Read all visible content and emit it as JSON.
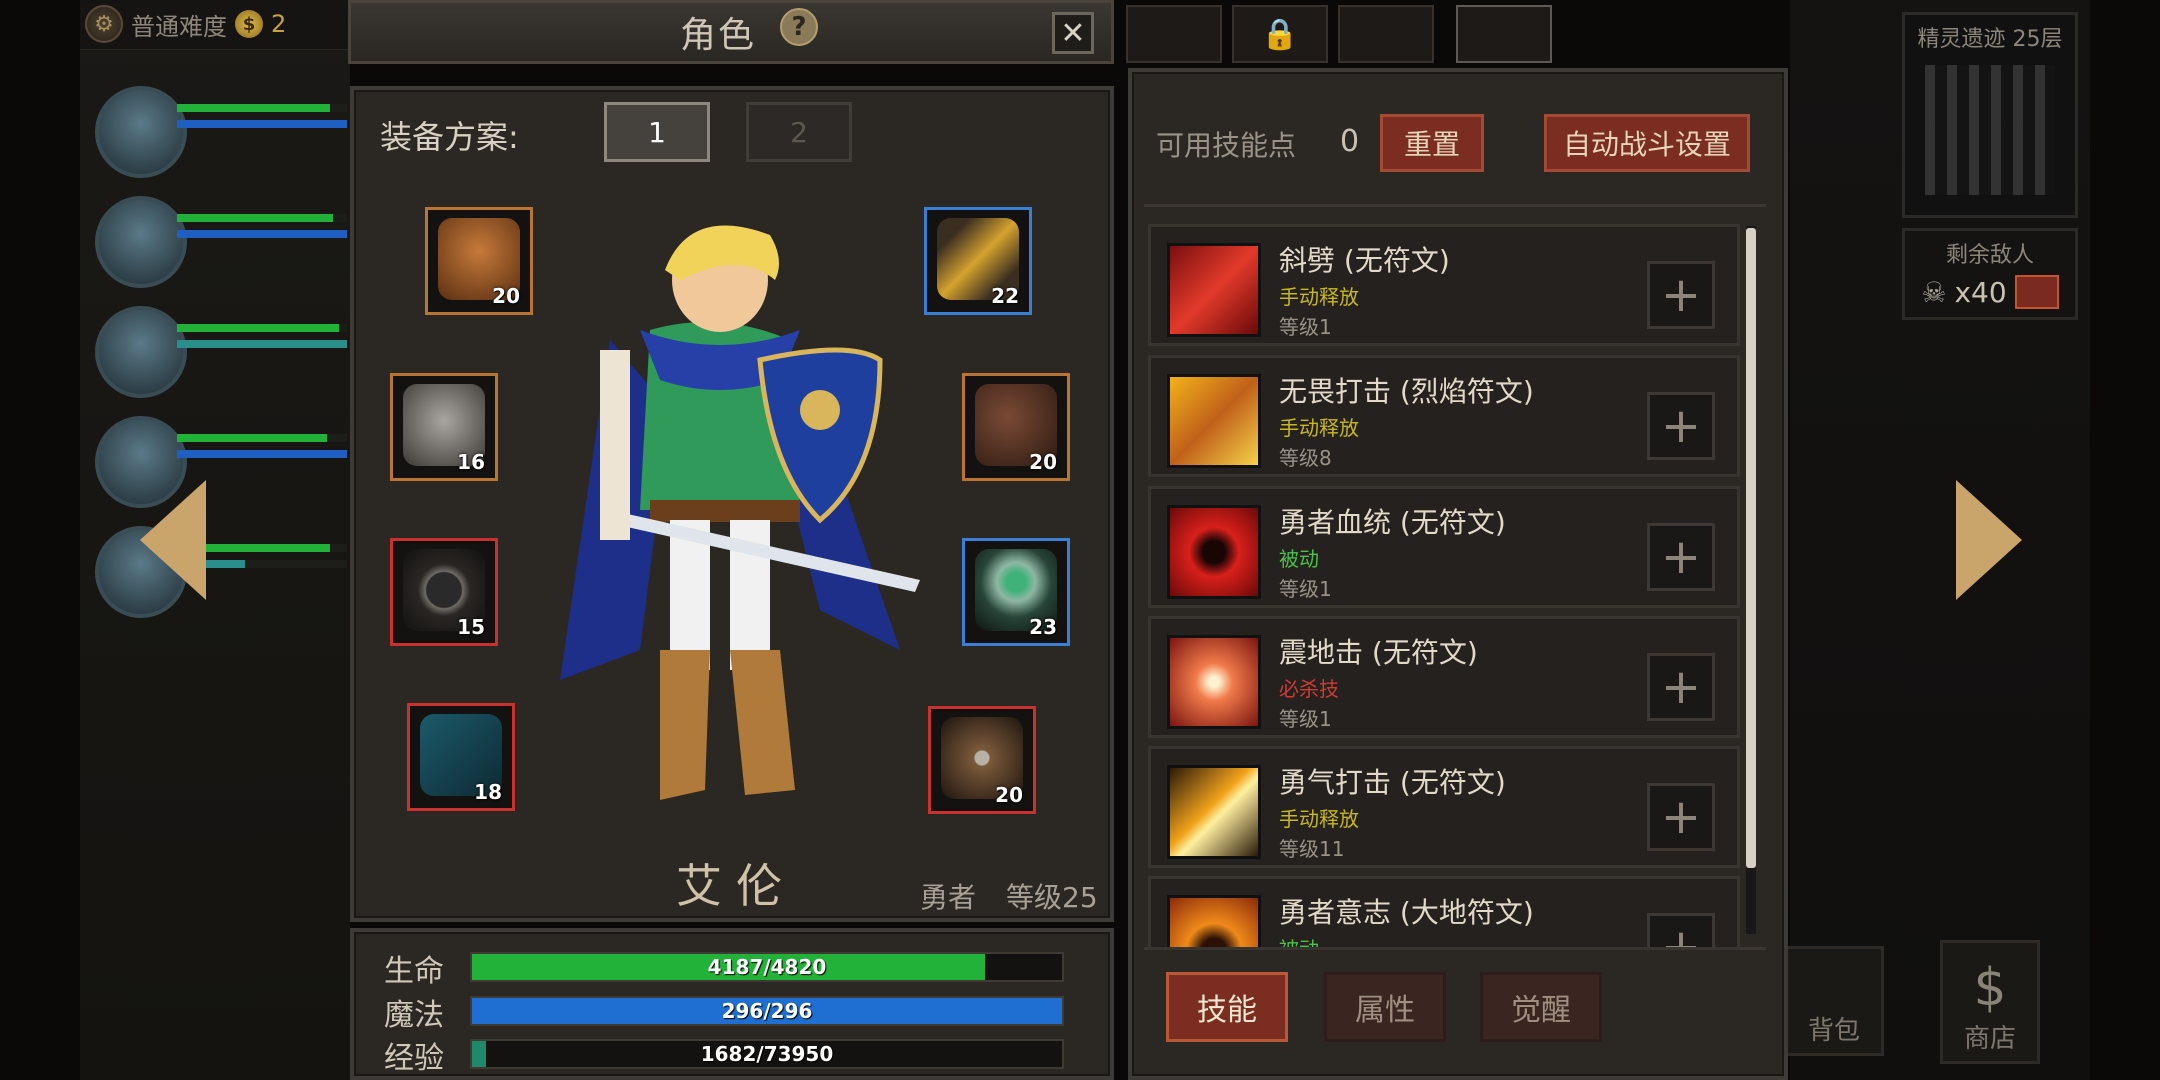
{
  "top": {
    "difficulty": "普通难度",
    "gold": "2"
  },
  "dungeon": {
    "title": "精灵遗迹 25层"
  },
  "enemies": {
    "label": "剩余敌人",
    "count": "x40"
  },
  "bottom_buttons": {
    "bag": "背包",
    "shop": "商店"
  },
  "dialog": {
    "title": "角色",
    "help": "?",
    "close": "✕"
  },
  "equipment": {
    "label": "装备方案:",
    "sets": [
      "1",
      "2"
    ],
    "slots": [
      {
        "name": "helmet",
        "level": "20",
        "rarity": "orange"
      },
      {
        "name": "armor",
        "level": "16",
        "rarity": "orange"
      },
      {
        "name": "belt",
        "level": "15",
        "rarity": "red"
      },
      {
        "name": "weapon-axe",
        "level": "18",
        "rarity": "red"
      },
      {
        "name": "amulet",
        "level": "22",
        "rarity": "blue"
      },
      {
        "name": "boots",
        "level": "20",
        "rarity": "orange"
      },
      {
        "name": "ring",
        "level": "23",
        "rarity": "blue"
      },
      {
        "name": "shield",
        "level": "20",
        "rarity": "red"
      }
    ]
  },
  "hero": {
    "name": "艾伦",
    "class": "勇者",
    "level": "等级25"
  },
  "stats": {
    "hp": {
      "label": "生命",
      "text": "4187/4820",
      "ratio": 0.869,
      "color": "#22b23a"
    },
    "mp": {
      "label": "魔法",
      "text": "296/296",
      "ratio": 1.0,
      "color": "#1e6fd1"
    },
    "exp": {
      "label": "经验",
      "text": "1682/73950",
      "ratio": 0.023,
      "color": "#1f8a6a"
    }
  },
  "skills_header": {
    "points_label": "可用技能点",
    "points": "0",
    "reset": "重置",
    "auto": "自动战斗设置"
  },
  "skills": [
    {
      "name": "斜劈 (无符文)",
      "type": "手动释放",
      "type_color": "#c8b81e",
      "level": "等级1",
      "icon": "slash-icon"
    },
    {
      "name": "无畏打击 (烈焰符文)",
      "type": "手动释放",
      "type_color": "#c8b81e",
      "level": "等级8",
      "icon": "fearless-strike-icon"
    },
    {
      "name": "勇者血统 (无符文)",
      "type": "被动",
      "type_color": "#4cc24a",
      "level": "等级1",
      "icon": "hero-bloodline-icon"
    },
    {
      "name": "震地击 (无符文)",
      "type": "必杀技",
      "type_color": "#d23a36",
      "level": "等级1",
      "icon": "ground-shock-icon"
    },
    {
      "name": "勇气打击 (无符文)",
      "type": "手动释放",
      "type_color": "#c8b81e",
      "level": "等级11",
      "icon": "courage-strike-icon"
    },
    {
      "name": "勇者意志 (大地符文)",
      "type": "被动",
      "type_color": "#4cc24a",
      "level": "",
      "icon": "hero-will-icon"
    }
  ],
  "tabs": [
    "技能",
    "属性",
    "觉醒"
  ]
}
